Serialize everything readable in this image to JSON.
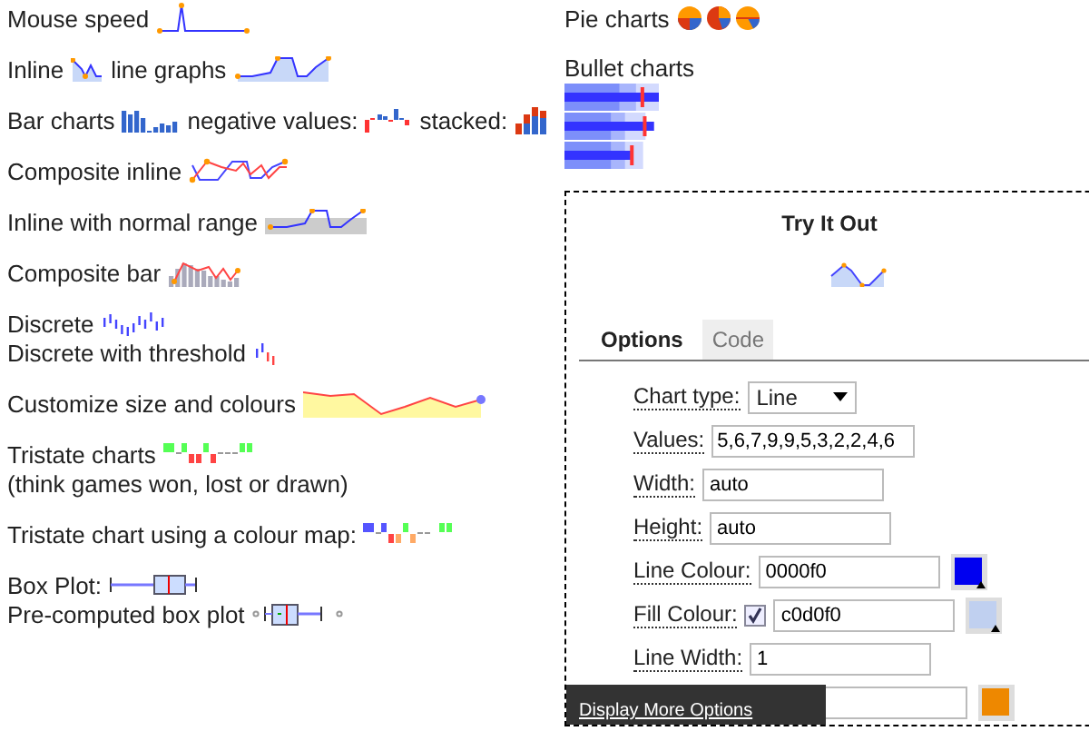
{
  "left": [
    {
      "lines": [
        {
          "parts": [
            {
              "text": "Mouse speed"
            },
            {
              "kind": "mouse"
            }
          ]
        }
      ]
    },
    {
      "lines": [
        {
          "parts": [
            {
              "text": "Inline"
            },
            {
              "kind": "inline-small"
            },
            {
              "text": "line graphs"
            },
            {
              "kind": "inline-line"
            }
          ]
        }
      ]
    },
    {
      "lines": [
        {
          "parts": [
            {
              "text": "Bar charts"
            },
            {
              "kind": "bar"
            },
            {
              "text": "negative values:"
            },
            {
              "kind": "bar-negative"
            },
            {
              "text": "stacked:"
            },
            {
              "kind": "bar-stacked"
            }
          ]
        }
      ]
    },
    {
      "lines": [
        {
          "parts": [
            {
              "text": "Composite inline"
            },
            {
              "kind": "composite-line"
            }
          ]
        }
      ]
    },
    {
      "lines": [
        {
          "parts": [
            {
              "text": "Inline with normal range"
            },
            {
              "kind": "normal-range"
            }
          ]
        }
      ]
    },
    {
      "lines": [
        {
          "parts": [
            {
              "text": "Composite bar"
            },
            {
              "kind": "composite-bar"
            }
          ]
        }
      ]
    },
    {
      "lines": [
        {
          "parts": [
            {
              "text": "Discrete"
            },
            {
              "kind": "discrete"
            }
          ]
        },
        {
          "parts": [
            {
              "text": "Discrete with threshold"
            },
            {
              "kind": "discrete-threshold"
            }
          ]
        }
      ]
    },
    {
      "lines": [
        {
          "parts": [
            {
              "text": "Customize size and colours"
            },
            {
              "kind": "custom"
            }
          ]
        }
      ]
    },
    {
      "lines": [
        {
          "parts": [
            {
              "text": "Tristate charts"
            },
            {
              "kind": "tristate"
            }
          ]
        },
        {
          "parts": [
            {
              "text": "(think games won, lost or drawn)"
            }
          ]
        }
      ]
    },
    {
      "lines": [
        {
          "parts": [
            {
              "text": "Tristate chart using a colour map:"
            },
            {
              "kind": "tristate-map"
            }
          ]
        }
      ]
    },
    {
      "lines": [
        {
          "parts": [
            {
              "text": "Box Plot:"
            },
            {
              "kind": "box"
            }
          ]
        },
        {
          "parts": [
            {
              "text": "Pre-computed box plot"
            },
            {
              "kind": "box-precomputed"
            }
          ]
        }
      ]
    }
  ],
  "pie": {
    "label": "Pie charts"
  },
  "bullet": {
    "label": "Bullet charts"
  },
  "try": {
    "title": "Try It Out",
    "tabs": [
      {
        "label": "Options",
        "selected": true
      },
      {
        "label": "Code",
        "selected": false
      }
    ],
    "fields": [
      {
        "kind": "select",
        "label": "Chart type:",
        "value": "Line"
      },
      {
        "kind": "text",
        "label": "Values:",
        "value": "5,6,7,9,9,5,3,2,2,4,6"
      },
      {
        "kind": "text",
        "label": "Width:",
        "value": "auto"
      },
      {
        "kind": "text",
        "label": "Height:",
        "value": "auto"
      },
      {
        "kind": "colour",
        "label": "Line Colour:",
        "value": "0000f0",
        "color": "#0000f0"
      },
      {
        "kind": "colour",
        "label": "Fill Colour:",
        "value": "c0d0f0",
        "color": "#c0d0f0",
        "checked": true
      },
      {
        "kind": "text",
        "label": "Line Width:",
        "value": "1"
      }
    ],
    "hidden_swatch": {
      "color": "#ee8800"
    },
    "more_link": "Display More Options"
  }
}
